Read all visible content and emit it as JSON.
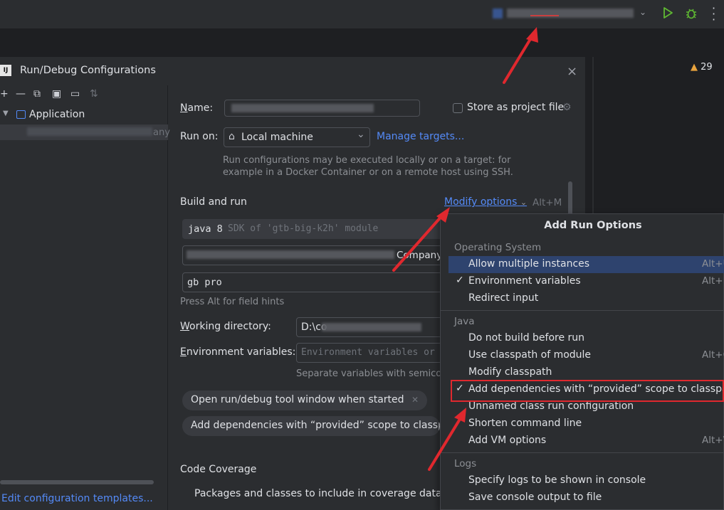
{
  "toolbar": {
    "run_icon": "play-icon",
    "debug_icon": "bug-icon",
    "more_icon": "more-vertical-icon",
    "chevron_icon": "chevron-down-icon"
  },
  "editor": {
    "warning_count": "29"
  },
  "dialog": {
    "title": "Run/Debug Configurations",
    "close_symbol": "×"
  },
  "left": {
    "tree_group": "Application",
    "partial_name": "any",
    "edit_templates": "Edit configuration templates..."
  },
  "form": {
    "name_label_first": "N",
    "name_label_rest": "ame:",
    "store_label": "Store as project file",
    "run_on_label": "Run on:",
    "run_on_value": "Local machine",
    "manage_targets": "Manage targets...",
    "run_on_hint": "Run configurations may be executed locally or on a target: for example in a Docker Container or on a remote host using SSH.",
    "section_build": "Build and run",
    "modify_options": "Modify options",
    "modify_shortcut": "Alt+M",
    "jdk_value_bold": "java 8",
    "jdk_value_rest": "SDK of 'gtb-big-k2h' module",
    "main_class_partial": "Company",
    "program_args": "gb pro",
    "field_hints": "Press Alt for field hints",
    "working_dir_label_first": "W",
    "working_dir_label_rest": "orking directory:",
    "working_dir_value": "D:\\co",
    "env_label_first": "E",
    "env_label_rest": "nvironment variables:",
    "env_placeholder": "Environment variables or",
    "env_hint": "Separate variables with semicol",
    "chip1": "Open run/debug tool window when started",
    "chip2": "Add dependencies with “provided” scope to classpat",
    "section_coverage": "Code Coverage",
    "coverage_packages": "Packages and classes to include in coverage data"
  },
  "popup": {
    "title": "Add Run Options",
    "groups": {
      "os": "Operating System",
      "java": "Java",
      "logs": "Logs"
    },
    "items": [
      {
        "label": "Allow multiple instances",
        "checked": false,
        "shortcut": "Alt+U",
        "selected": true
      },
      {
        "label": "Environment variables",
        "checked": true,
        "shortcut": "Alt+E"
      },
      {
        "label": "Redirect input",
        "checked": false,
        "shortcut": ""
      },
      {
        "label": "Do not build before run",
        "checked": false,
        "shortcut": ""
      },
      {
        "label": "Use classpath of module",
        "checked": false,
        "shortcut": "Alt+O"
      },
      {
        "label": "Modify classpath",
        "checked": false,
        "shortcut": ""
      },
      {
        "label": "Add dependencies with “provided” scope to classpath",
        "checked": true,
        "shortcut": ""
      },
      {
        "label": "Unnamed class run configuration",
        "checked": false,
        "shortcut": ""
      },
      {
        "label": "Shorten command line",
        "checked": false,
        "shortcut": ""
      },
      {
        "label": "Add VM options",
        "checked": false,
        "shortcut": "Alt+V"
      },
      {
        "label": "Specify logs to be shown in console",
        "checked": false,
        "shortcut": ""
      },
      {
        "label": "Save console output to file",
        "checked": false,
        "shortcut": ""
      }
    ],
    "check_symbol": "✓"
  },
  "colors": {
    "accent": "#548af7",
    "selection": "#2e436e",
    "annotation_red": "#e0282e",
    "run_green": "#5fb832"
  }
}
